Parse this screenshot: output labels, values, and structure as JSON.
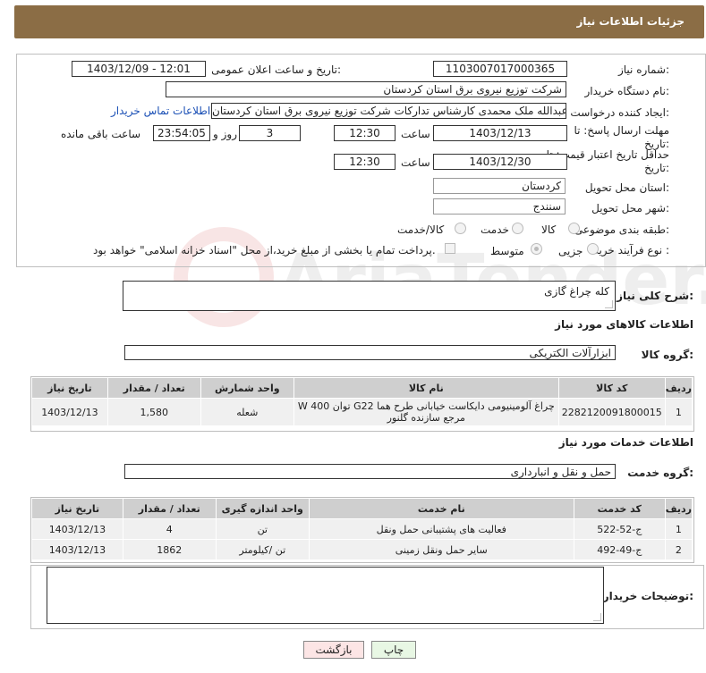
{
  "header": {
    "title": "جزئیات اطلاعات نیاز"
  },
  "form": {
    "need_number_label": "شماره نیاز:",
    "need_number": "1103007017000365",
    "announce_label": "تاریخ و ساعت اعلان عمومی:",
    "announce_value": "1403/12/09 - 12:01",
    "buyer_org_label": "نام دستگاه خریدار:",
    "buyer_org": "شرکت توزیع نیروی برق استان کردستان",
    "creator_label": "ایجاد کننده درخواست:",
    "creator": "عبدالله ملک محمدی کارشناس تدارکات شرکت توزیع نیروی برق استان کردستان",
    "contact_link": "اطلاعات تماس خریدار",
    "deadline_label": "مهلت ارسال پاسخ: تا تاریخ:",
    "deadline_date": "1403/12/13",
    "time_label": "ساعت",
    "deadline_time": "12:30",
    "days_value": "3",
    "days_label": "روز و",
    "remaining_time": "23:54:05",
    "remaining_label": "ساعت باقی مانده",
    "validity_label": "حداقل تاریخ اعتبار قیمت: تا تاریخ:",
    "validity_date": "1403/12/30",
    "validity_time": "12:30",
    "province_label": "استان محل تحویل:",
    "province": "کردستان",
    "city_label": "شهر محل تحویل:",
    "city": "سنندج",
    "category_label": "طبقه بندی موضوعی:",
    "category_options": [
      "کالا",
      "خدمت",
      "کالا/خدمت"
    ],
    "purchase_type_label": "نوع فرآیند خرید :",
    "purchase_options": [
      "جزیی",
      "متوسط"
    ],
    "payment_note": "پرداخت تمام یا بخشی از مبلغ خرید،از محل \"اسناد خزانه اسلامی\" خواهد بود."
  },
  "summary": {
    "label": "شرح کلی نیاز:",
    "value": "کله چراغ گازی"
  },
  "goods": {
    "section_title": "اطلاعات کالاهای مورد نیاز",
    "group_label": "گروه کالا:",
    "group_value": "ابزارآلات الکتریکی",
    "columns": [
      "ردیف",
      "کد کالا",
      "نام کالا",
      "واحد شمارش",
      "تعداد / مقدار",
      "تاریخ نیاز"
    ],
    "rows": [
      {
        "idx": "1",
        "code": "2282120091800015",
        "name_line1": "چراغ آلومینیومی دایکاست خیابانی طرح هما G22 توان 400 W",
        "name_line2": "مرجع سازنده گلنور",
        "unit": "شعله",
        "qty": "1,580",
        "date": "1403/12/13"
      }
    ]
  },
  "services": {
    "section_title": "اطلاعات خدمات مورد نیاز",
    "group_label": "گروه خدمت:",
    "group_value": "حمل و نقل و انبارداری",
    "columns": [
      "ردیف",
      "کد خدمت",
      "نام خدمت",
      "واحد اندازه گیری",
      "تعداد / مقدار",
      "تاریخ نیاز"
    ],
    "rows": [
      {
        "idx": "1",
        "code": "ج-52-522",
        "name": "فعالیت های پشتیبانی حمل ونقل",
        "unit": "تن",
        "qty": "4",
        "date": "1403/12/13"
      },
      {
        "idx": "2",
        "code": "ج-49-492",
        "name": "سایر حمل ونقل زمینی",
        "unit": "تن /کیلومتر",
        "qty": "1862",
        "date": "1403/12/13"
      }
    ]
  },
  "buyer_notes": {
    "label": "توضیحات خریدار:",
    "value": ""
  },
  "buttons": {
    "print": "چاپ",
    "back": "بازگشت"
  },
  "watermark": {
    "text": "AriaTender.neT"
  }
}
